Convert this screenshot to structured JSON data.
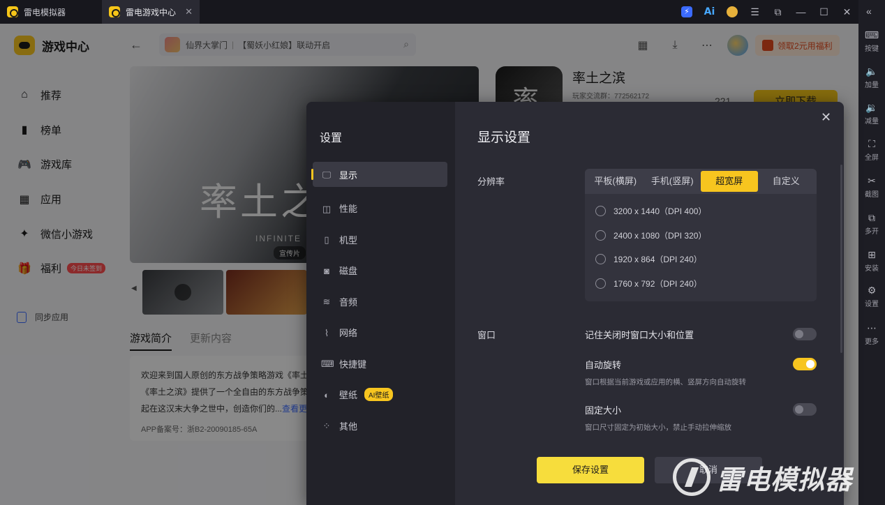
{
  "titlebar": {
    "tabs": [
      {
        "label": "雷电模拟器"
      },
      {
        "label": "雷电游戏中心",
        "close": "✕"
      }
    ],
    "icons": {
      "ai": "Ai",
      "menu": "☰",
      "popout": "⧉",
      "minimize": "—",
      "maximize": "☐",
      "close": "✕"
    }
  },
  "rightbar": {
    "collapse": "«",
    "items": [
      {
        "icon": "⌨",
        "label": "按键"
      },
      {
        "icon": "🔈",
        "label": "加量"
      },
      {
        "icon": "🔉",
        "label": "减量"
      },
      {
        "icon": "⛶",
        "label": "全屏"
      },
      {
        "icon": "✂",
        "label": "截图"
      },
      {
        "icon": "⧉",
        "label": "多开"
      },
      {
        "icon": "⊞",
        "label": "安装"
      },
      {
        "icon": "⚙",
        "label": "设置"
      },
      {
        "icon": "⋯",
        "label": "更多"
      }
    ]
  },
  "sidebar": {
    "logo": "游戏中心",
    "nav": [
      {
        "label": "推荐",
        "icon": "⌂"
      },
      {
        "label": "榜单",
        "icon": "▮"
      },
      {
        "label": "游戏库",
        "icon": "🎮"
      },
      {
        "label": "应用",
        "icon": "▦"
      },
      {
        "label": "微信小游戏",
        "icon": "✦"
      },
      {
        "label": "福利",
        "icon": "🎁",
        "badge": "今日未签到"
      }
    ],
    "sync": "同步应用"
  },
  "topbar": {
    "search_game": "仙界大掌门",
    "search_text": "【蜀妖小红娘】联动开启",
    "welfare": "领取2元用福利"
  },
  "banner": {
    "title": "率土之",
    "sub": "INFINITE",
    "tag": "宣传片"
  },
  "game": {
    "name": "率土之滨",
    "group": "玩家交流群：772562172",
    "count": "221",
    "download": "立即下载",
    "icon_text": "率"
  },
  "game_tabs": [
    "游戏简介",
    "更新内容"
  ],
  "intro": {
    "line1": "欢迎来到国人原创的东方战争策略游戏《率土",
    "line2": "《率土之滨》提供了一个全自由的东方战争策",
    "line3": "起在这汉末大争之世中，创造你们的...",
    "more": "查看更多",
    "icp": "APP备案号：浙B2-20090185-65A"
  },
  "settings": {
    "title": "设置",
    "nav": [
      {
        "label": "显示",
        "icon": "🖵"
      },
      {
        "label": "性能",
        "icon": "◫"
      },
      {
        "label": "机型",
        "icon": "▯"
      },
      {
        "label": "磁盘",
        "icon": "◙"
      },
      {
        "label": "音频",
        "icon": "≋"
      },
      {
        "label": "网络",
        "icon": "⌇"
      },
      {
        "label": "快捷键",
        "icon": "⌨"
      },
      {
        "label": "壁纸",
        "icon": "◐",
        "badge": "AI壁纸"
      },
      {
        "label": "其他",
        "icon": "⁘"
      }
    ],
    "panel_title": "显示设置",
    "close": "✕",
    "resolution": {
      "label": "分辨率",
      "tabs": [
        "平板(横屏)",
        "手机(竖屏)",
        "超宽屏",
        "自定义"
      ],
      "active_tab": 2,
      "options": [
        "3200 x 1440（DPI 400）",
        "2400 x 1080（DPI 320）",
        "1920 x 864（DPI 240）",
        "1760 x 792（DPI 240）"
      ]
    },
    "window": {
      "label": "窗口",
      "options": [
        {
          "title": "记住关闭时窗口大小和位置",
          "desc": "",
          "on": false
        },
        {
          "title": "自动旋转",
          "desc": "窗口根据当前游戏或应用的横、竖屏方向自动旋转",
          "on": true
        },
        {
          "title": "固定大小",
          "desc": "窗口尺寸固定为初始大小，禁止手动拉伸缩放",
          "on": false
        }
      ]
    },
    "save": "保存设置",
    "cancel": "取消"
  },
  "watermark": "雷电模拟器",
  "colors": {
    "accent": "#f7c51f",
    "modal_bg": "#2b2b34",
    "modal_nav_bg": "#222229"
  }
}
